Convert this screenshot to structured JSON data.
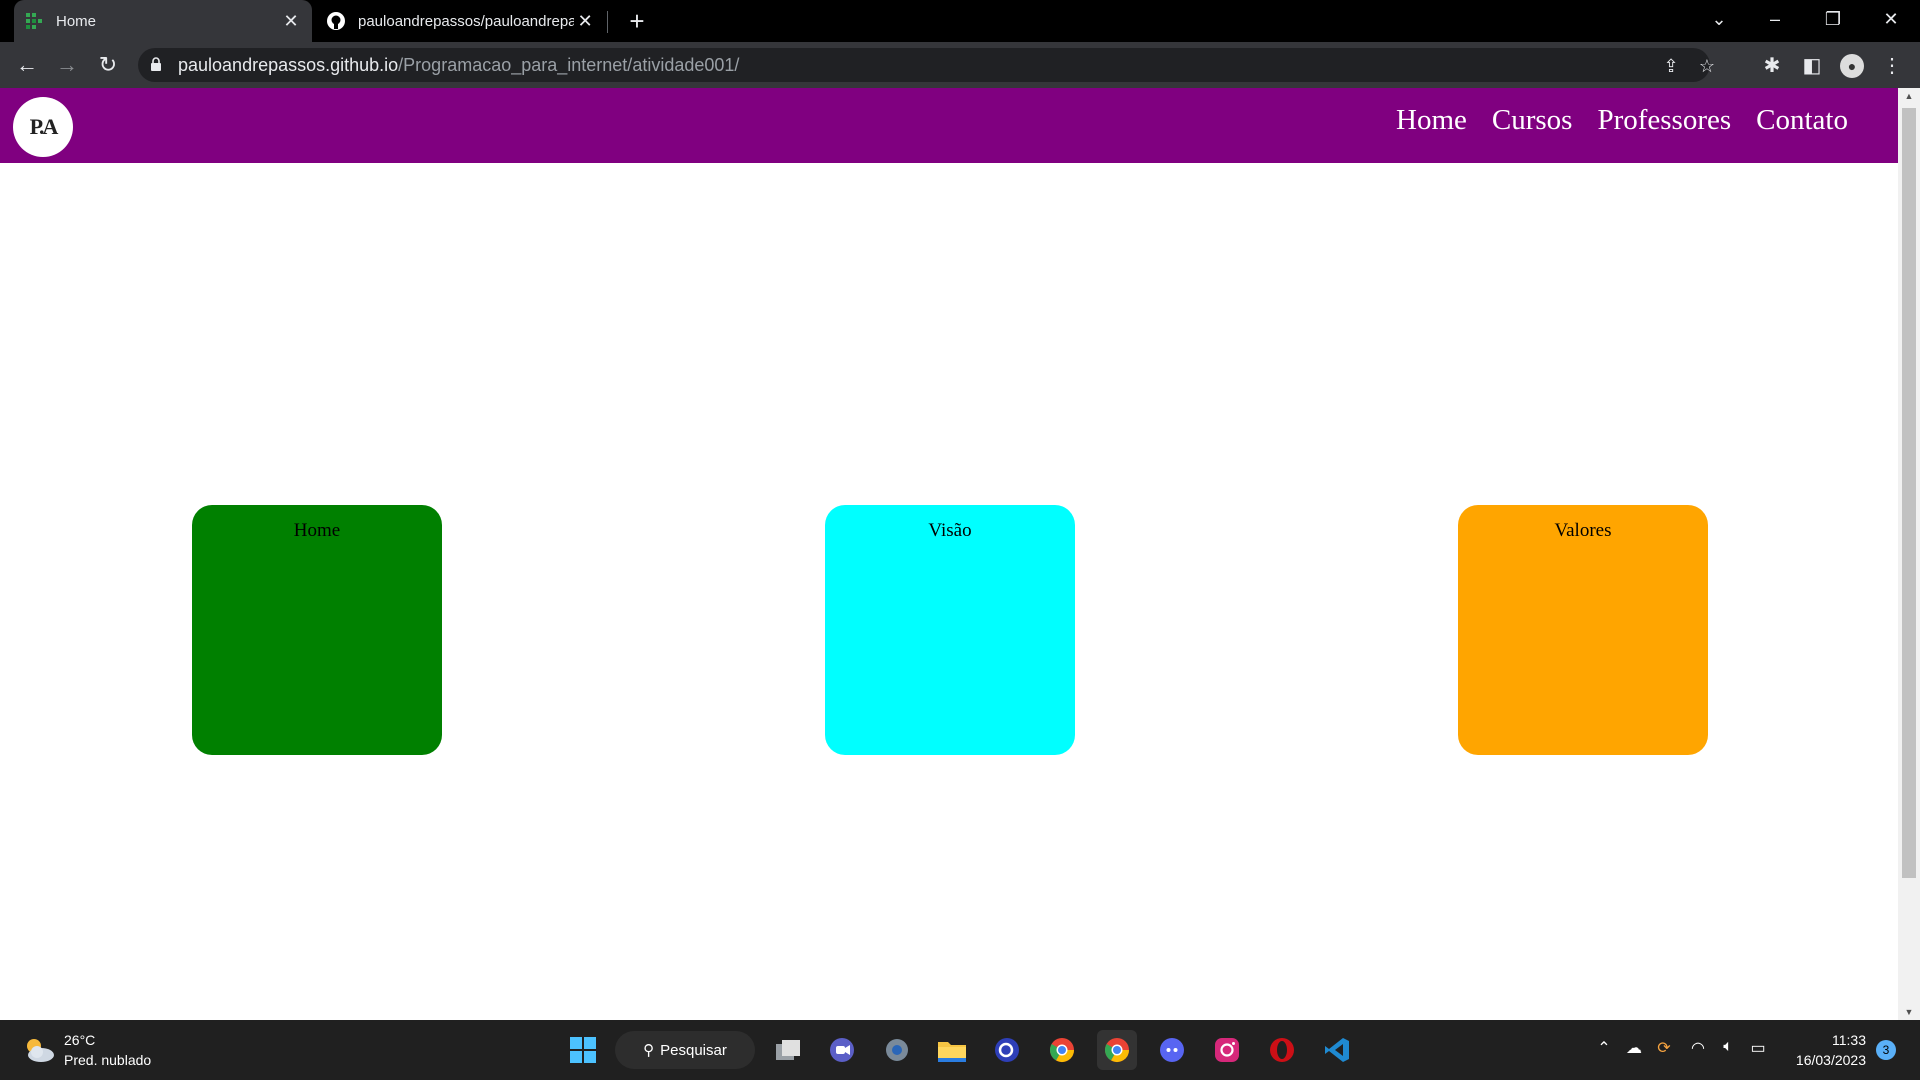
{
  "browser": {
    "tabs": [
      {
        "title": "Home",
        "active": true
      },
      {
        "title": "pauloandrepassos/pauloandrepa",
        "active": false
      }
    ],
    "url_host": "pauloandrepassos.github.io",
    "url_path": "/Programacao_para_internet/atividade001/"
  },
  "site": {
    "logo_text": "P.A",
    "nav": [
      "Home",
      "Cursos",
      "Professores",
      "Contato"
    ],
    "cards": [
      {
        "label": "Home",
        "color": "#008000"
      },
      {
        "label": "Visão",
        "color": "#00ffff"
      },
      {
        "label": "Valores",
        "color": "#ffa500"
      }
    ],
    "header_color": "#800080"
  },
  "taskbar": {
    "weather_temp": "26°C",
    "weather_desc": "Pred. nublado",
    "search_label": "Pesquisar",
    "time": "11:33",
    "date": "16/03/2023",
    "notification_count": "3",
    "apps": [
      "windows-start-icon",
      "task-view-icon",
      "teams-icon",
      "settings-icon",
      "file-explorer-icon",
      "app-icon",
      "chrome-icon",
      "chrome-profile-icon",
      "discord-icon",
      "instagram-icon",
      "opera-icon",
      "vscode-icon"
    ]
  }
}
